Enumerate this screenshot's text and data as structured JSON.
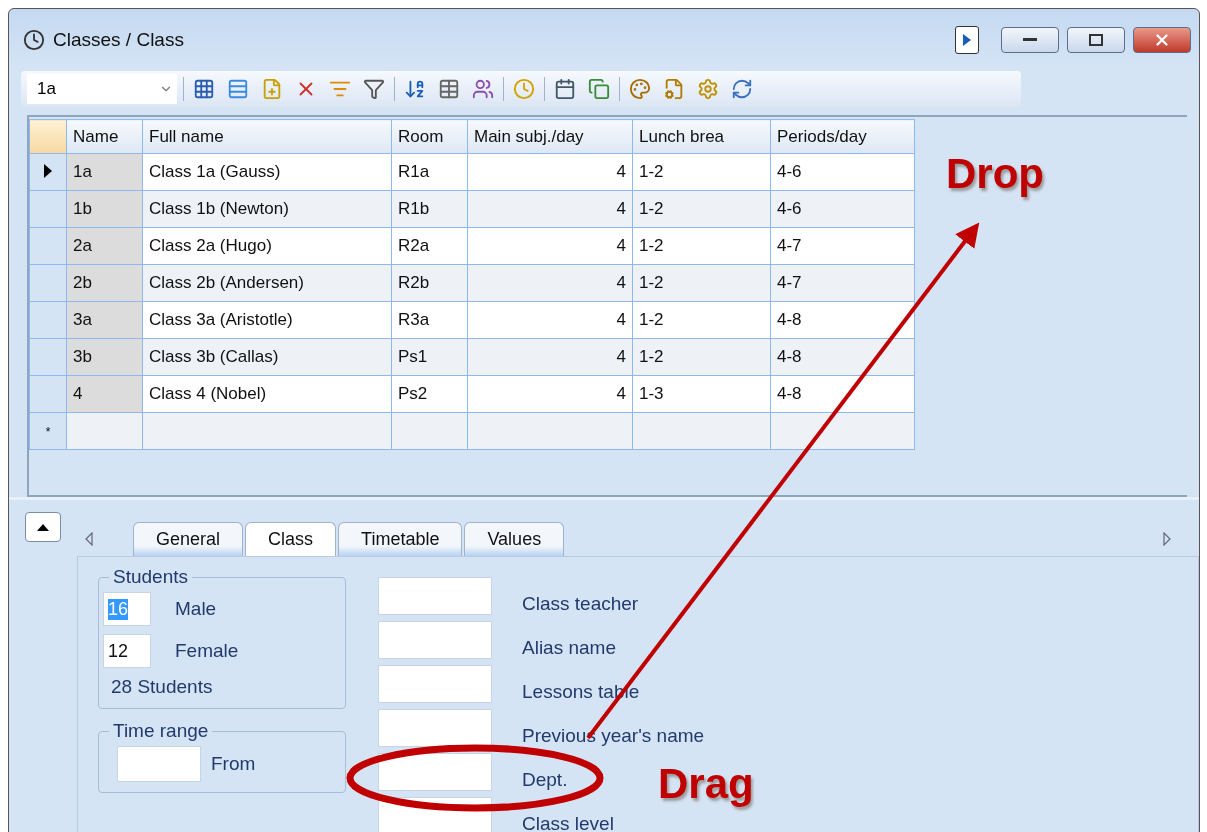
{
  "window": {
    "title": "Classes / Class"
  },
  "toolbar": {
    "combo_value": "1a"
  },
  "table": {
    "columns": [
      "Name",
      "Full name",
      "Room",
      "Main subj./day",
      "Lunch brea",
      "Periods/day"
    ],
    "rows": [
      {
        "selected": true,
        "cells": [
          "1a",
          "Class 1a (Gauss)",
          "R1a",
          "4",
          "1-2",
          "4-6"
        ]
      },
      {
        "selected": false,
        "cells": [
          "1b",
          "Class 1b (Newton)",
          "R1b",
          "4",
          "1-2",
          "4-6"
        ]
      },
      {
        "selected": false,
        "cells": [
          "2a",
          "Class 2a (Hugo)",
          "R2a",
          "4",
          "1-2",
          "4-7"
        ]
      },
      {
        "selected": false,
        "cells": [
          "2b",
          "Class 2b (Andersen)",
          "R2b",
          "4",
          "1-2",
          "4-7"
        ]
      },
      {
        "selected": false,
        "cells": [
          "3a",
          "Class 3a (Aristotle)",
          "R3a",
          "4",
          "1-2",
          "4-8"
        ]
      },
      {
        "selected": false,
        "cells": [
          "3b",
          "Class 3b (Callas)",
          "Ps1",
          "4",
          "1-2",
          "4-8"
        ]
      },
      {
        "selected": false,
        "cells": [
          "4",
          "Class 4 (Nobel)",
          "Ps2",
          "4",
          "1-3",
          "4-8"
        ]
      }
    ],
    "new_row_marker": "*"
  },
  "tabs": [
    {
      "label": "General",
      "selected": false
    },
    {
      "label": "Class",
      "selected": true
    },
    {
      "label": "Timetable",
      "selected": false
    },
    {
      "label": "Values",
      "selected": false
    }
  ],
  "students": {
    "title": "Students",
    "fields": [
      {
        "value": "16",
        "label": "Male",
        "highlighted": true
      },
      {
        "value": "12",
        "label": "Female",
        "highlighted": false
      }
    ],
    "total": "28 Students"
  },
  "time_range": {
    "title": "Time range",
    "fields": [
      {
        "label": "From"
      }
    ]
  },
  "fields": [
    {
      "label": "Class teacher"
    },
    {
      "label": "Alias name"
    },
    {
      "label": "Lessons table"
    },
    {
      "label": "Previous year's name"
    },
    {
      "label": "Dept."
    },
    {
      "label": "Class level"
    }
  ],
  "annotations": {
    "drop": "Drop",
    "drag": "Drag"
  }
}
